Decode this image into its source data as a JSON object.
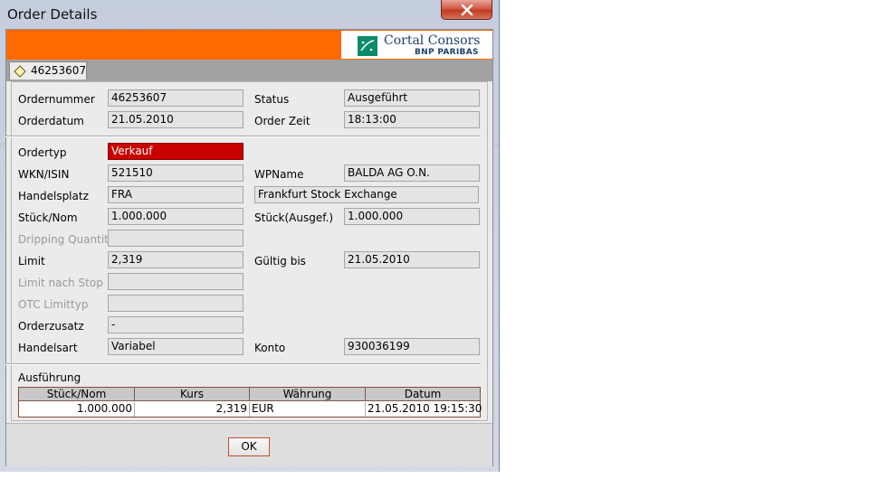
{
  "window": {
    "title": "Order Details",
    "close_glyph": "✕"
  },
  "brand": {
    "name": "Cortal Consors",
    "subtitle": "BNP PARIBAS",
    "banner_color": "#ff6a00"
  },
  "tab": {
    "label": "46253607"
  },
  "fields": {
    "ordernummer": {
      "label": "Ordernummer",
      "value": "46253607"
    },
    "status": {
      "label": "Status",
      "value": "Ausgeführt"
    },
    "orderdatum": {
      "label": "Orderdatum",
      "value": "21.05.2010"
    },
    "orderzeit": {
      "label": "Order Zeit",
      "value": "18:13:00"
    },
    "ordertyp": {
      "label": "Ordertyp",
      "value": "Verkauf"
    },
    "wkn": {
      "label": "WKN/ISIN",
      "value": "521510"
    },
    "wpname": {
      "label": "WPName",
      "value": "BALDA AG O.N."
    },
    "handelsplatz": {
      "label": "Handelsplatz",
      "value": "FRA",
      "description": "Frankfurt Stock Exchange"
    },
    "stueck": {
      "label": "Stück/Nom",
      "value": "1.000.000"
    },
    "stueck_ausgef": {
      "label": "Stück(Ausgef.)",
      "value": "1.000.000"
    },
    "dripping": {
      "label": "Dripping Quantity",
      "value": ""
    },
    "limit": {
      "label": "Limit",
      "value": "2,319"
    },
    "gueltig": {
      "label": "Gültig bis",
      "value": "21.05.2010"
    },
    "limit_stop": {
      "label": "Limit nach Stop",
      "value": ""
    },
    "otc": {
      "label": "OTC Limittyp",
      "value": ""
    },
    "orderzusatz": {
      "label": "Orderzusatz",
      "value": "-"
    },
    "handelsart": {
      "label": "Handelsart",
      "value": "Variabel"
    },
    "konto": {
      "label": "Konto",
      "value": "930036199"
    }
  },
  "execution": {
    "title": "Ausführung",
    "headers": [
      "Stück/Nom",
      "Kurs",
      "Währung",
      "Datum"
    ],
    "rows": [
      [
        "1.000.000",
        "2,319",
        "EUR",
        "21.05.2010 19:15:30"
      ]
    ]
  },
  "ok_label": "OK",
  "colors": {
    "ordertyp_sell": "#c80000",
    "close_button": "#c23b22"
  }
}
